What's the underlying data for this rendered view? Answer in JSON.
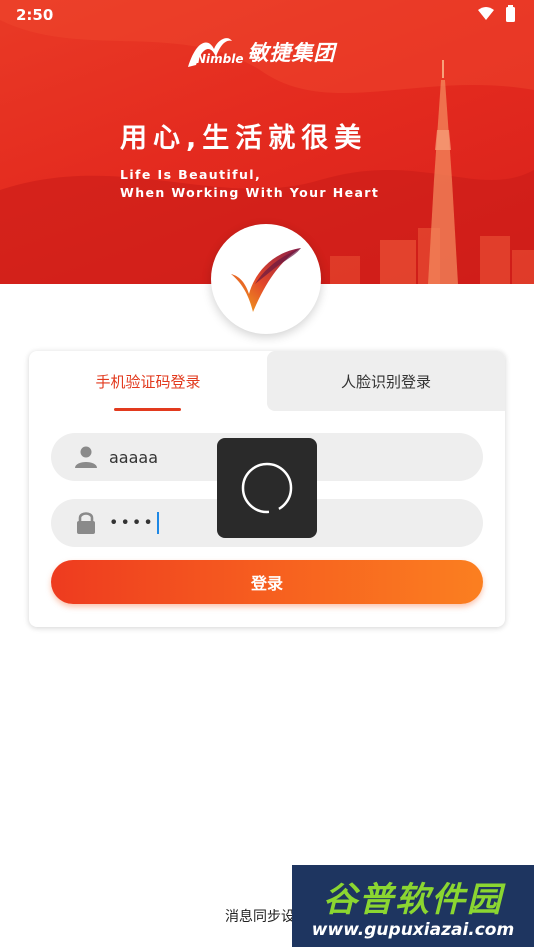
{
  "status_bar": {
    "time": "2:50"
  },
  "header": {
    "brand_latin": "Nimble",
    "brand_cn": "敏捷集团",
    "slogan_cn": "用心,生活就很美",
    "slogan_en_line1": "Life Is Beautiful,",
    "slogan_en_line2": "When Working With Your Heart"
  },
  "tabs": [
    {
      "label": "手机验证码登录",
      "active": true
    },
    {
      "label": "人脸识别登录",
      "active": false
    }
  ],
  "form": {
    "username": {
      "value": "aaaaa",
      "icon": "person-icon"
    },
    "password": {
      "value": "••••",
      "icon": "lock-icon"
    },
    "login_label": "登录"
  },
  "footer": {
    "message_sync": "消息同步设置"
  },
  "watermark": {
    "title": "谷普软件园",
    "url": "www.gupuxiazai.com"
  },
  "colors": {
    "accent": "#e23a1e",
    "button_start": "#ee3b1f",
    "button_end": "#fb7f20"
  }
}
